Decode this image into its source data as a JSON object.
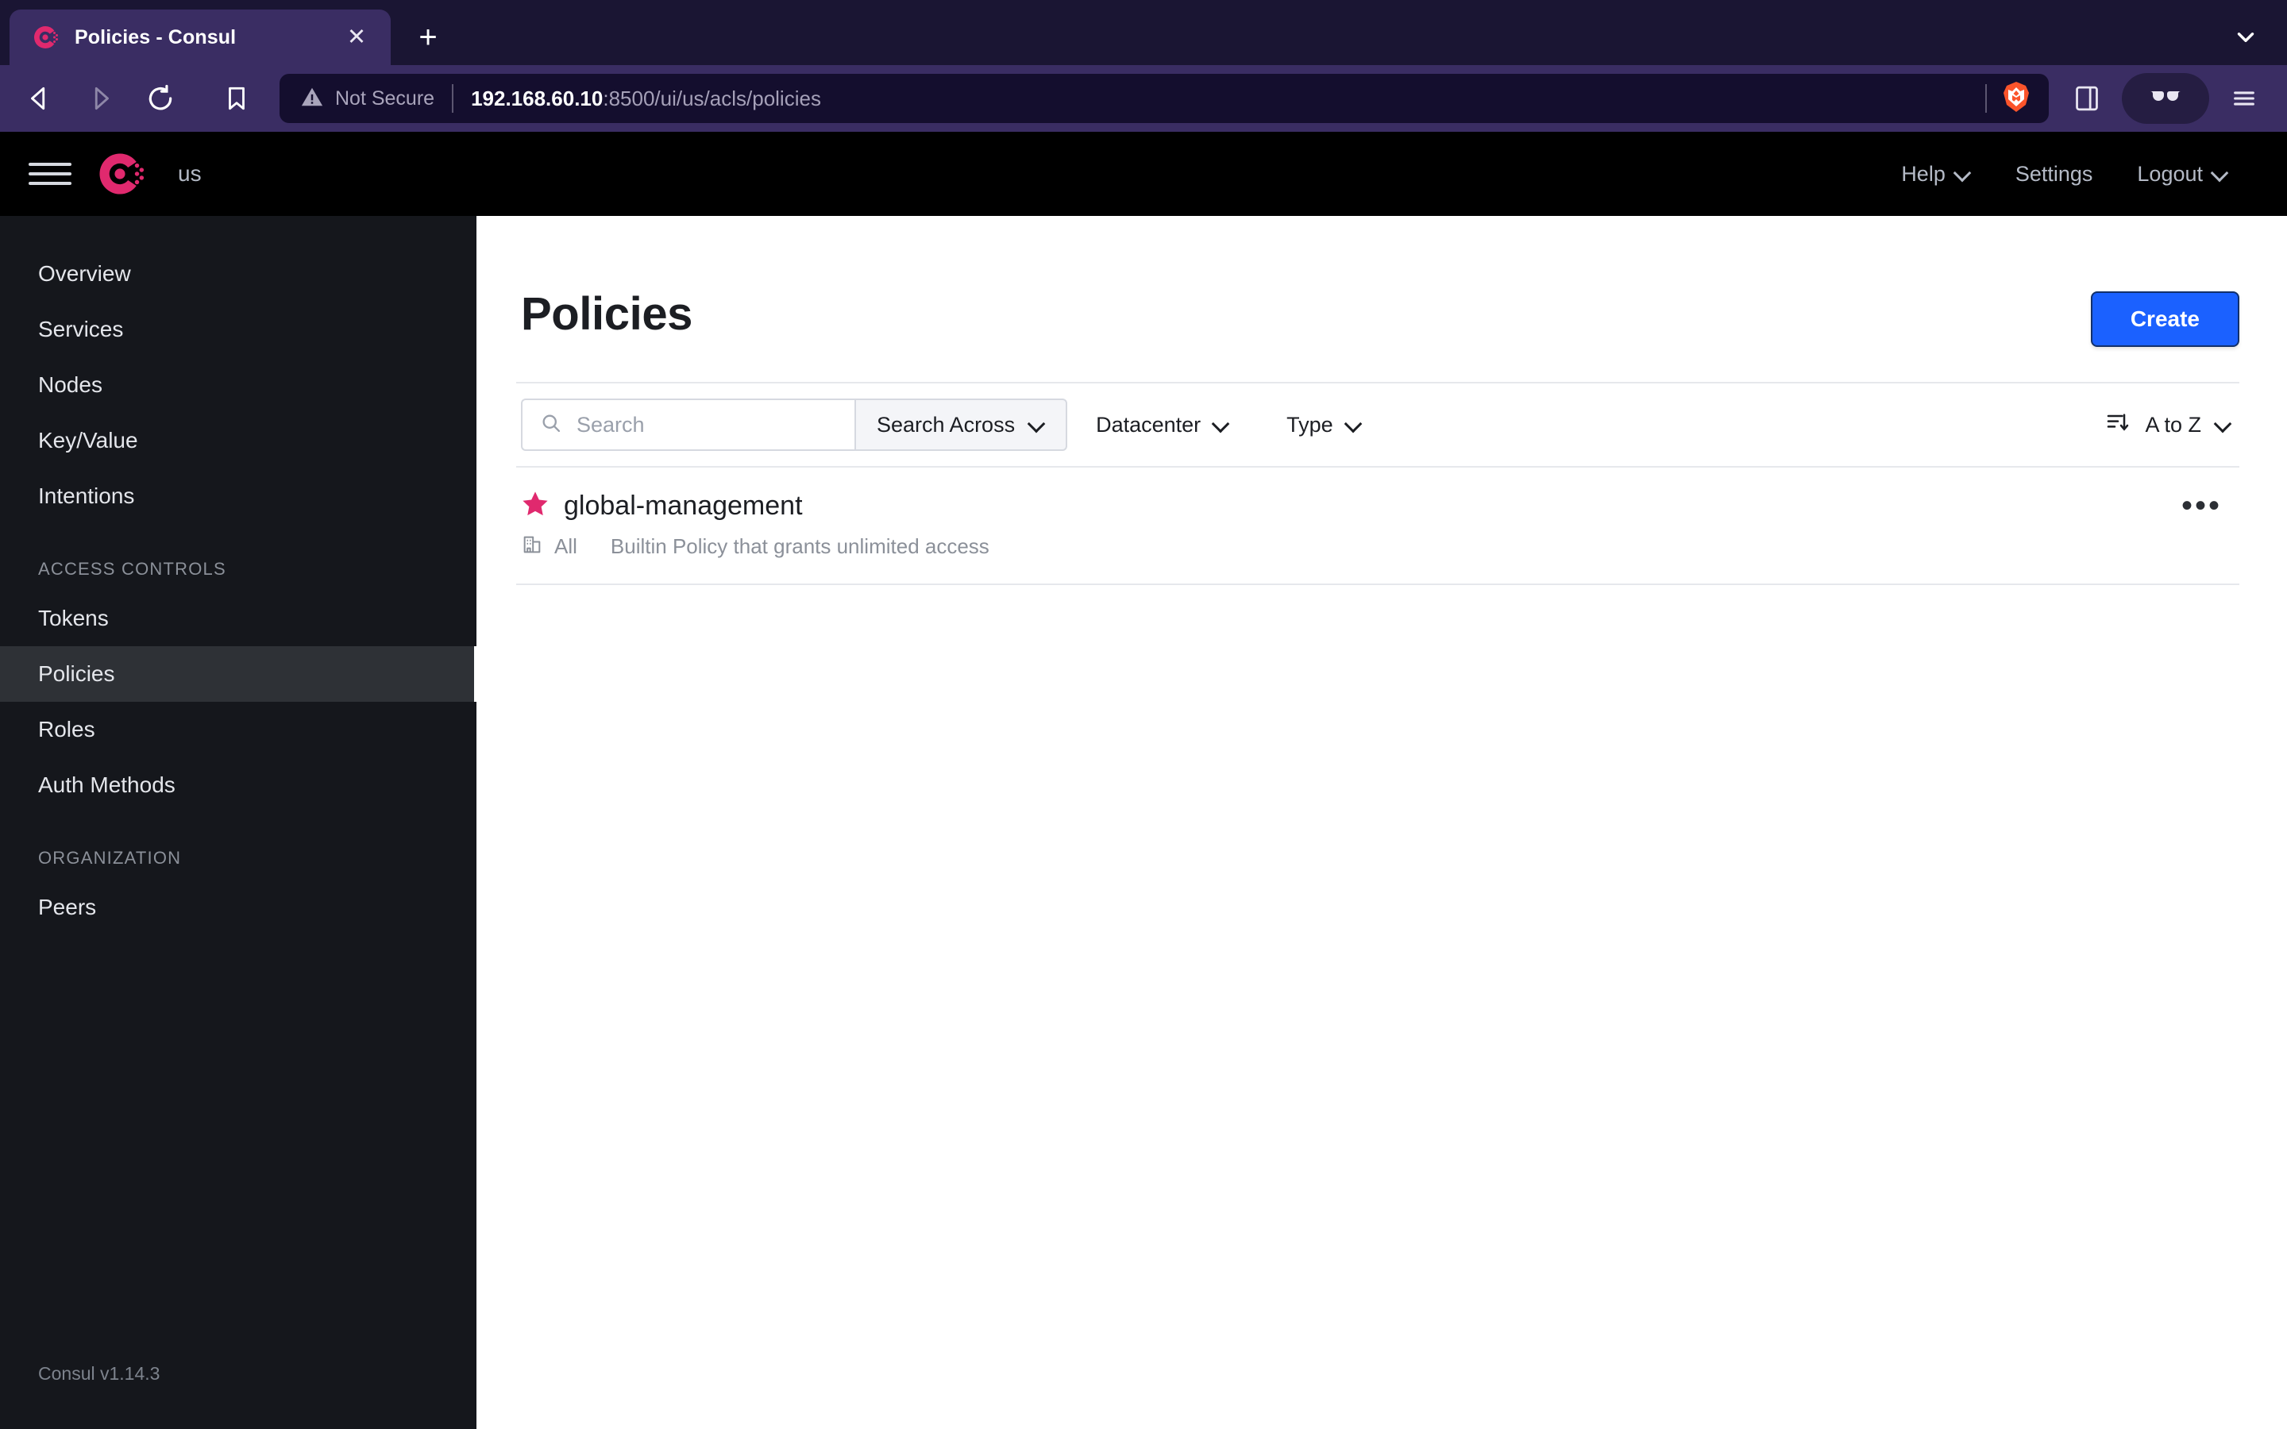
{
  "browser": {
    "tab": {
      "title": "Policies - Consul",
      "favicon_icon": "consul-logo-icon",
      "close_icon": "close-icon"
    },
    "new_tab_label": "+",
    "tab_list_icon": "chevron-down-icon",
    "nav": {
      "back_icon": "back-arrow-icon",
      "forward_icon": "forward-arrow-icon",
      "reload_icon": "reload-icon",
      "bookmark_icon": "bookmark-icon"
    },
    "address_bar": {
      "security_icon": "warning-triangle-icon",
      "security_label": "Not Secure",
      "url_host": "192.168.60.10",
      "url_rest": ":8500/ui/us/acls/policies",
      "shields_icon": "brave-shields-lion-icon"
    },
    "toolbar_right": {
      "sidebar_icon": "sidebar-panel-icon",
      "private_window_icon": "glasses-icon",
      "menu_icon": "hamburger-menu-icon"
    },
    "colors": {
      "tabstrip_bg": "#1A1533",
      "tab_active_bg": "#3A2D63",
      "toolbar_bg": "#3A2D63",
      "urlbar_bg": "#140E2E",
      "brave_orange": "#FB542B"
    }
  },
  "app_header": {
    "menu_icon": "hamburger-menu-icon",
    "logo_icon": "consul-logo-icon",
    "datacenter": "us",
    "nav": [
      {
        "label": "Help",
        "icon": "chevron-down-icon",
        "has_chevron": true
      },
      {
        "label": "Settings",
        "icon": "",
        "has_chevron": false
      },
      {
        "label": "Logout",
        "icon": "chevron-down-icon",
        "has_chevron": true
      }
    ]
  },
  "sidebar": {
    "items": [
      {
        "label": "Overview",
        "selected": false
      },
      {
        "label": "Services",
        "selected": false
      },
      {
        "label": "Nodes",
        "selected": false
      },
      {
        "label": "Key/Value",
        "selected": false
      },
      {
        "label": "Intentions",
        "selected": false
      }
    ],
    "groups": [
      {
        "title": "ACCESS CONTROLS",
        "items": [
          {
            "label": "Tokens",
            "selected": false
          },
          {
            "label": "Policies",
            "selected": true
          },
          {
            "label": "Roles",
            "selected": false
          },
          {
            "label": "Auth Methods",
            "selected": false
          }
        ]
      },
      {
        "title": "ORGANIZATION",
        "items": [
          {
            "label": "Peers",
            "selected": false
          }
        ]
      }
    ],
    "footer": "Consul v1.14.3"
  },
  "main": {
    "title": "Policies",
    "create_label": "Create",
    "filters": {
      "search_icon": "search-icon",
      "search_placeholder": "Search",
      "search_value": "",
      "search_across_label": "Search Across",
      "datacenter_label": "Datacenter",
      "type_label": "Type",
      "sort_icon": "sort-descending-icon",
      "sort_label": "A to Z"
    },
    "policies": [
      {
        "star_icon": "star-icon",
        "name": "global-management",
        "datacenter_icon": "datacenter-building-icon",
        "datacenter": "All",
        "description": "Builtin Policy that grants unlimited access",
        "menu_icon": "more-horizontal-icon"
      }
    ]
  },
  "colors": {
    "accent_blue": "#1B61FF",
    "consul_pink": "#E0296E",
    "sidebar_bg": "#15171C",
    "header_bg": "#000000"
  }
}
